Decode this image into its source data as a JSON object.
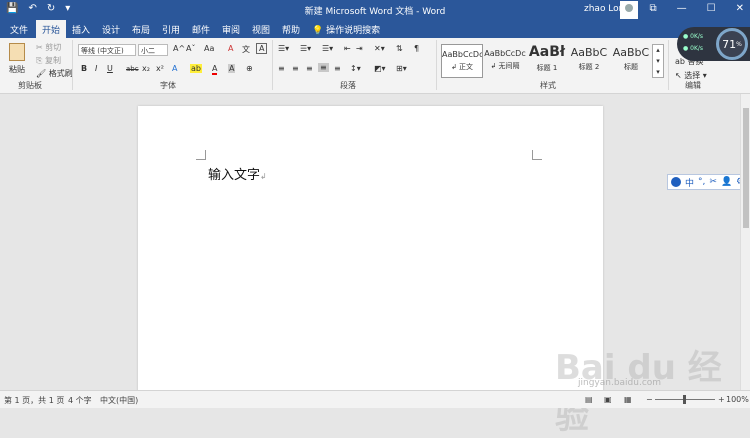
{
  "titlebar": {
    "title": "新建 Microsoft Word 文档 - Word",
    "user": "zhao Lori",
    "quick_access": {
      "save": "💾",
      "undo": "↶",
      "redo": "↻",
      "customize": "▾"
    },
    "window": {
      "restore": "⧉",
      "minimize": "—",
      "maximize": "☐",
      "close": "✕"
    }
  },
  "tabs": [
    {
      "label": "文件"
    },
    {
      "label": "开始"
    },
    {
      "label": "插入"
    },
    {
      "label": "设计"
    },
    {
      "label": "布局"
    },
    {
      "label": "引用"
    },
    {
      "label": "邮件"
    },
    {
      "label": "审阅"
    },
    {
      "label": "视图"
    },
    {
      "label": "帮助"
    }
  ],
  "tellme": "操作说明搜索",
  "ribbon": {
    "clipboard": {
      "paste": "粘贴",
      "cut": "剪切",
      "copy": "复制",
      "format_painter": "格式刷",
      "label": "剪贴板"
    },
    "font": {
      "family": "等线 (中文正)",
      "size": "小二",
      "label": "字体",
      "buttons": {
        "bold": "B",
        "italic": "I",
        "underline": "U",
        "strike": "abc",
        "sub": "x₂",
        "sup": "x²",
        "grow": "A^",
        "shrink": "Aˇ",
        "case": "Aa",
        "clear": "A",
        "phonetic": "文",
        "border": "A"
      }
    },
    "paragraph": {
      "label": "段落"
    },
    "styles": {
      "label": "样式",
      "items": [
        {
          "sample": "AaBbCcDc",
          "name": "↲ 正文"
        },
        {
          "sample": "AaBbCcDc",
          "name": "↲ 无间隔"
        },
        {
          "sample": "AaBł",
          "name": "标题 1"
        },
        {
          "sample": "AaBbC",
          "name": "标题 2"
        },
        {
          "sample": "AaBbC",
          "name": "标题"
        }
      ]
    },
    "editing": {
      "replace": "替换",
      "select": "选择",
      "label": "编辑"
    }
  },
  "document": {
    "text": "输入文字"
  },
  "widgets": {
    "gauge": "71",
    "gauge_unit": "%",
    "net_up": "0K/s",
    "net_down": "0K/s",
    "ime_mode": "中"
  },
  "status": {
    "page": "第 1 页，共 1 页",
    "words": "4 个字",
    "lang": "中文(中国)",
    "zoom": "100%"
  },
  "watermark": {
    "brand": "Bai du 经验",
    "url": "jingyan.baidu.com"
  }
}
